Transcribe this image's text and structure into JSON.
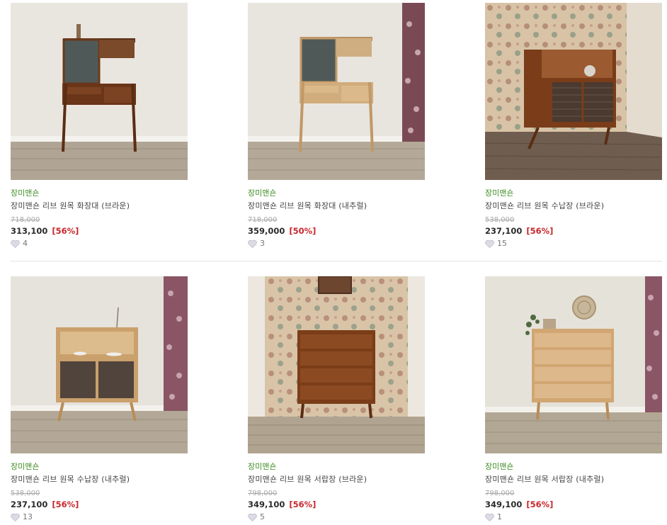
{
  "products": [
    {
      "brand": "장미맨숀",
      "name": "장미맨숀 리브 원목 화장대 (브라운)",
      "original_price": "718,000",
      "price": "313,100",
      "discount": "[56%]",
      "likes": "4",
      "image": "vanity-brown"
    },
    {
      "brand": "장미맨숀",
      "name": "장미맨숀 리브 원목 화장대 (내추럴)",
      "original_price": "718,000",
      "price": "359,000",
      "discount": "[50%]",
      "likes": "3",
      "image": "vanity-natural"
    },
    {
      "brand": "장미맨숀",
      "name": "장미맨숀 리브 원목 수납장 (브라운)",
      "original_price": "538,000",
      "price": "237,100",
      "discount": "[56%]",
      "likes": "15",
      "image": "cabinet-brown"
    },
    {
      "brand": "장미맨숀",
      "name": "장미맨숀 리브 원목 수납장 (내추럴)",
      "original_price": "538,000",
      "price": "237,100",
      "discount": "[56%]",
      "likes": "13",
      "image": "cabinet-natural"
    },
    {
      "brand": "장미맨숀",
      "name": "장미맨숀 리브 원목 서랍장 (브라운)",
      "original_price": "798,000",
      "price": "349,100",
      "discount": "[56%]",
      "likes": "5",
      "image": "drawer-brown"
    },
    {
      "brand": "장미맨숀",
      "name": "장미맨숀 리브 원목 서랍장 (내추럴)",
      "original_price": "798,000",
      "price": "349,100",
      "discount": "[56%]",
      "likes": "1",
      "image": "drawer-natural"
    }
  ],
  "colors": {
    "brand": "#3f8d22",
    "discount": "#c8262b",
    "original": "#a8a8a8"
  }
}
